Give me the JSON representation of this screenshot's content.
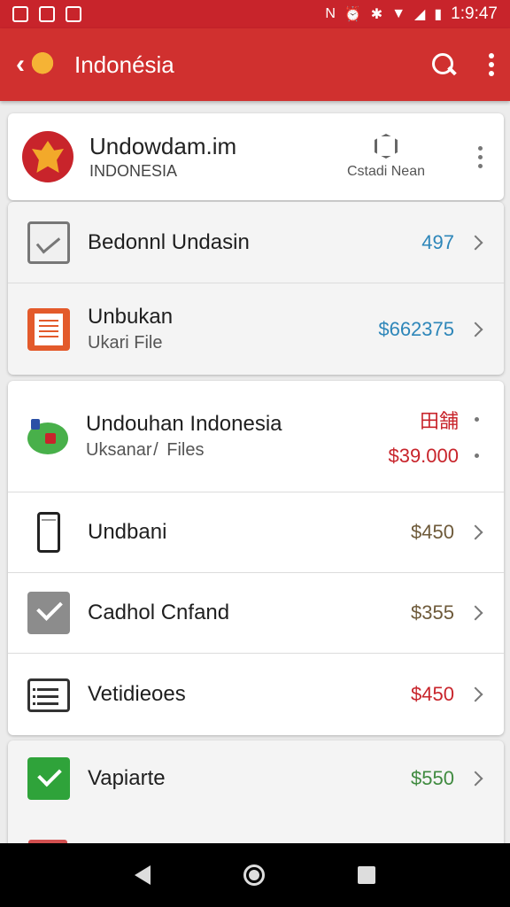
{
  "status_bar": {
    "time": "1:9:47",
    "right_icons": [
      "nfc-icon",
      "alarm-icon",
      "bluetooth-icon",
      "wifi-icon",
      "signal-icon",
      "battery-icon"
    ]
  },
  "app_bar": {
    "title": "Indonésia"
  },
  "header_card": {
    "title": "Undowdam.im",
    "subtitle": "INDONESIA",
    "action_label": "Cstadi Nean"
  },
  "group1": [
    {
      "label": "Bedonnl Undasin",
      "value": "497",
      "value_color": "#2d86b9"
    },
    {
      "label": "Unbukan",
      "sub": "Ukari File",
      "value": "$662375",
      "value_color": "#2d86b9"
    }
  ],
  "featured": {
    "label": "Undouhan Indonesia",
    "sub": "Uksanar /  Files",
    "value_top": "田舗",
    "value_bottom": "$39.000",
    "value_color": "#c8242b"
  },
  "group2": [
    {
      "label": "Undbani",
      "value": "$450",
      "value_color": "#6e5a3a"
    },
    {
      "label": "Cadhol Cnfand",
      "value": "$355",
      "value_color": "#6e5a3a"
    },
    {
      "label": "Vetidieoes",
      "value": "$450",
      "value_color": "#c8242b"
    }
  ],
  "group3": [
    {
      "label": "Vapiarte",
      "value": "$550",
      "value_color": "#3f8a3f"
    }
  ],
  "colors": {
    "app_bar": "#d0302f",
    "status_bar": "#c8242b"
  }
}
